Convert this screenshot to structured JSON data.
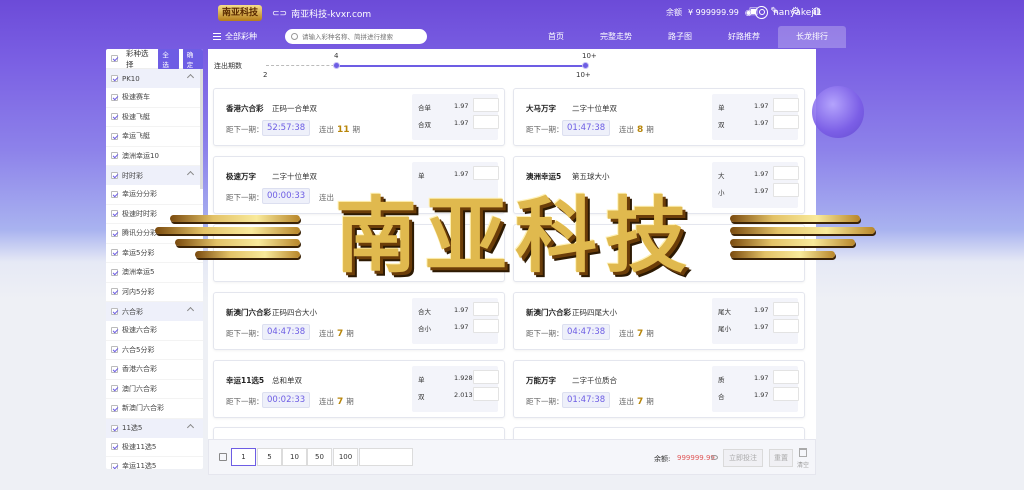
{
  "header": {
    "logo_text": "南亚科技",
    "site_name": "南亚科技-kvxr.com",
    "username": "nanyakeji1",
    "balance_label": "余额",
    "balance_value": "¥ 999999.99"
  },
  "nav": {
    "all_lottery": "全部彩种",
    "search_placeholder": "请输入彩种名称、简拼进行搜索",
    "links": [
      "首页",
      "完整走势",
      "路子图",
      "好路推荐",
      "长龙排行"
    ],
    "active": "长龙排行"
  },
  "sidebar": {
    "header_label": "彩种选择",
    "select_all": "全选",
    "confirm": "确定",
    "groups": [
      {
        "name": "PK10",
        "items": [
          "极速赛车",
          "极速飞艇",
          "幸运飞艇",
          "澳洲幸运10"
        ]
      },
      {
        "name": "时时彩",
        "items": [
          "幸运分分彩",
          "极速时时彩",
          "腾讯分分彩",
          "幸运5分彩",
          "澳洲幸运5",
          "河内5分彩"
        ]
      },
      {
        "name": "六合彩",
        "items": [
          "极速六合彩",
          "六合5分彩",
          "香港六合彩",
          "澳门六合彩",
          "新澳门六合彩"
        ]
      },
      {
        "name": "11选5",
        "items": [
          "极速11选5",
          "幸运11选5"
        ]
      }
    ]
  },
  "slider": {
    "label": "连出期数",
    "min_label": "2",
    "max_label": "10+",
    "low_value": "4",
    "high_value": "10+"
  },
  "cards": [
    {
      "name": "香港六合彩",
      "play": "正码一合单双",
      "next_label": "距下一期：",
      "timer": "52:57:38",
      "streak_label": "连出",
      "streak": "11",
      "unit": "期",
      "odds": [
        {
          "name": "合单",
          "value": "1.97"
        },
        {
          "name": "合双",
          "value": "1.97"
        }
      ]
    },
    {
      "name": "大马万字",
      "play": "二字十位单双",
      "next_label": "距下一期：",
      "timer": "01:47:38",
      "streak_label": "连出",
      "streak": "8",
      "unit": "期",
      "odds": [
        {
          "name": "单",
          "value": "1.97"
        },
        {
          "name": "双",
          "value": "1.97"
        }
      ]
    },
    {
      "name": "极速万字",
      "play": "二字十位单双",
      "next_label": "距下一期：",
      "timer": "00:00:33",
      "streak_label": "连出",
      "streak": "",
      "unit": "",
      "odds": [
        {
          "name": "单",
          "value": "1.97"
        },
        {
          "name": "",
          "value": ""
        }
      ]
    },
    {
      "name": "澳洲幸运5",
      "play": "第五球大小",
      "next_label": "",
      "timer": "",
      "streak_label": "",
      "streak": "",
      "unit": "",
      "odds": [
        {
          "name": "大",
          "value": "1.97"
        },
        {
          "name": "小",
          "value": "1.97"
        }
      ]
    },
    {
      "name": "新澳门六合彩",
      "play": "正码四合大小",
      "next_label": "距下一期：",
      "timer": "04:47:38",
      "streak_label": "连出",
      "streak": "7",
      "unit": "期",
      "odds": [
        {
          "name": "合大",
          "value": "1.97"
        },
        {
          "name": "合小",
          "value": "1.97"
        }
      ]
    },
    {
      "name": "新澳门六合彩",
      "play": "正码四尾大小",
      "next_label": "距下一期：",
      "timer": "04:47:38",
      "streak_label": "连出",
      "streak": "7",
      "unit": "期",
      "odds": [
        {
          "name": "尾大",
          "value": "1.97"
        },
        {
          "name": "尾小",
          "value": "1.97"
        }
      ]
    },
    {
      "name": "幸运11选5",
      "play": "总和单双",
      "next_label": "距下一期：",
      "timer": "00:02:33",
      "streak_label": "连出",
      "streak": "7",
      "unit": "期",
      "odds": [
        {
          "name": "单",
          "value": "1.928"
        },
        {
          "name": "双",
          "value": "2.013"
        }
      ]
    },
    {
      "name": "万能万字",
      "play": "二字千位质合",
      "next_label": "距下一期：",
      "timer": "01:47:38",
      "streak_label": "连出",
      "streak": "7",
      "unit": "期",
      "odds": [
        {
          "name": "质",
          "value": "1.97"
        },
        {
          "name": "合",
          "value": "1.97"
        }
      ]
    }
  ],
  "bottom": {
    "amounts": [
      "1",
      "5",
      "10",
      "50",
      "100"
    ],
    "balance_label": "余额:",
    "balance_value": "999999.99",
    "confirm_label": "立即投注",
    "reset_label": "重置",
    "clear_label": "清空"
  },
  "watermark": {
    "text": "南亚科技"
  },
  "colors": {
    "accent": "#6d5de4",
    "streak": "#b8860b",
    "balance": "#e05a5a"
  }
}
